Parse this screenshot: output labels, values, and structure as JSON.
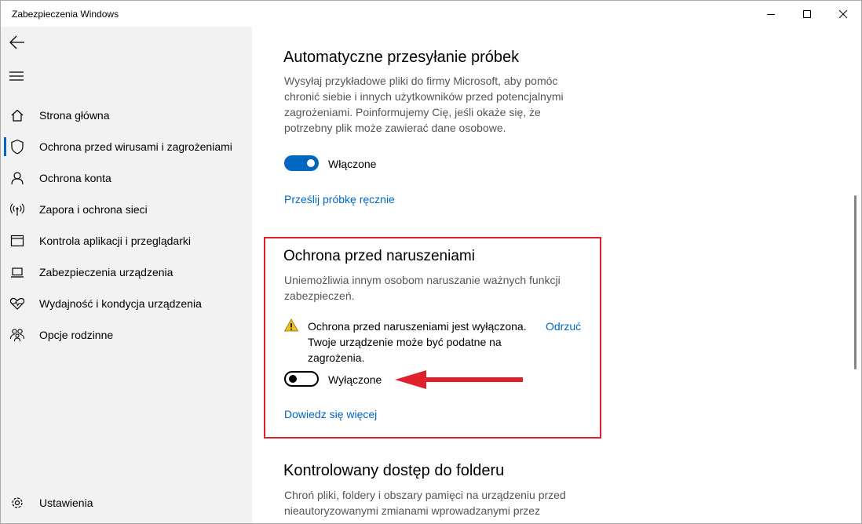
{
  "window": {
    "title": "Zabezpieczenia Windows"
  },
  "sidebar": {
    "items": [
      {
        "label": "Strona główna",
        "icon": "home-icon"
      },
      {
        "label": "Ochrona przed wirusami i zagrożeniami",
        "icon": "shield-icon",
        "selected": true
      },
      {
        "label": "Ochrona konta",
        "icon": "person-icon"
      },
      {
        "label": "Zapora i ochrona sieci",
        "icon": "wireless-icon"
      },
      {
        "label": "Kontrola aplikacji i przeglądarki",
        "icon": "app-browser-icon"
      },
      {
        "label": "Zabezpieczenia urządzenia",
        "icon": "laptop-icon"
      },
      {
        "label": "Wydajność i kondycja urządzenia",
        "icon": "heart-pulse-icon"
      },
      {
        "label": "Opcje rodzinne",
        "icon": "family-icon"
      }
    ],
    "settings_label": "Ustawienia"
  },
  "sample_submission": {
    "title": "Automatyczne przesyłanie próbek",
    "desc_lines": [
      "Wysyłaj przykładowe pliki do firmy Microsoft, aby pomóc",
      "chronić siebie i innych użytkowników przed potencjalnymi",
      "zagrożeniami. Poinformujemy Cię, jeśli okaże się, że",
      "potrzebny plik może zawierać dane osobowe."
    ],
    "toggle_state": "on",
    "toggle_label": "Włączone",
    "link": "Prześlij próbkę ręcznie"
  },
  "tamper_protection": {
    "title": "Ochrona przed naruszeniami",
    "desc_lines": [
      "Uniemożliwia innym osobom naruszanie ważnych funkcji",
      "zabezpieczeń."
    ],
    "warning_lines": [
      "Ochrona przed naruszeniami jest wyłączona.",
      "Twoje urządzenie może być podatne na",
      "zagrożenia."
    ],
    "dismiss": "Odrzuć",
    "toggle_state": "off",
    "toggle_label": "Wyłączone",
    "link": "Dowiedz się więcej"
  },
  "folder_access": {
    "title": "Kontrolowany dostęp do folderu",
    "desc_lines": [
      "Chroń pliki, foldery i obszary pamięci na urządzeniu przed",
      "nieautoryzowanymi zmianami wprowadzanymi przez"
    ]
  },
  "colors": {
    "accent": "#0067c0",
    "highlight_box": "#e0202a",
    "arrow": "#e0202a",
    "warning": "#f2c01d"
  }
}
